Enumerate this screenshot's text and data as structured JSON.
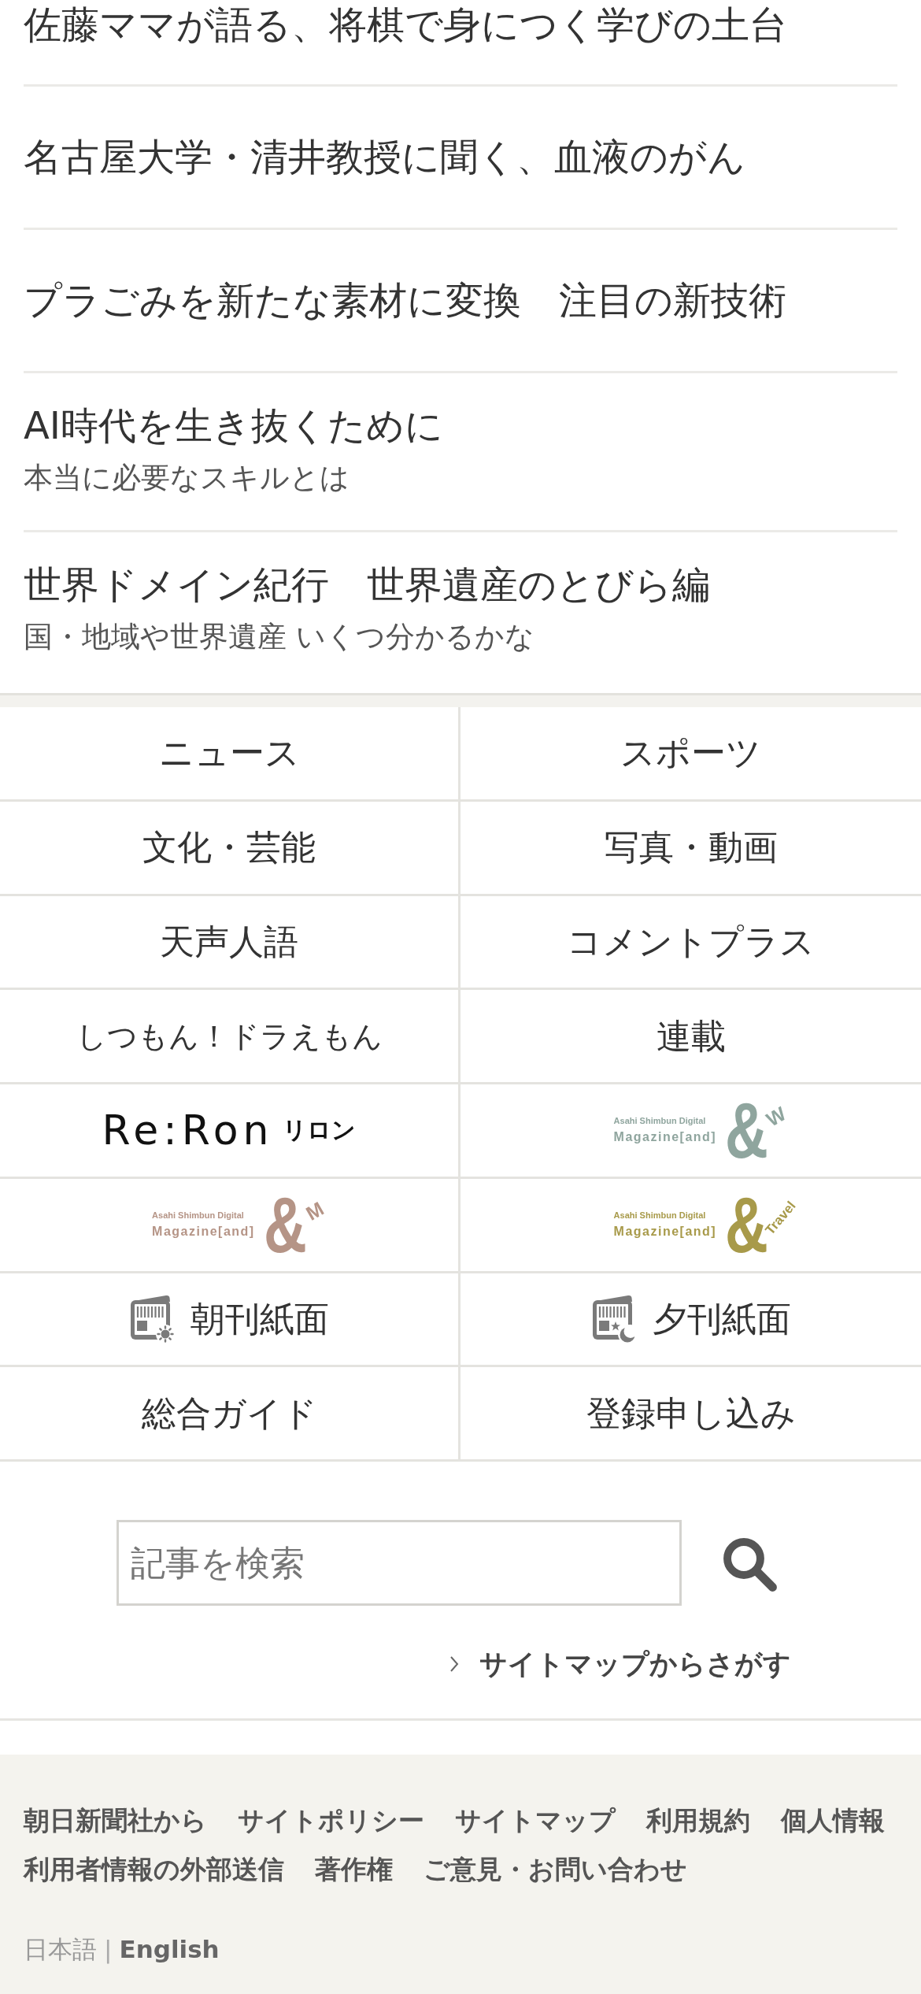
{
  "article_list": [
    {
      "title": "佐藤ママが語る、将棋で身につく学びの土台"
    },
    {
      "title": "名古屋大学・清井教授に聞く、血液のがん"
    },
    {
      "title": "プラごみを新たな素材に変換　注目の新技術"
    },
    {
      "title": "AI時代を生き抜くために",
      "subtitle": "本当に必要なスキルとは"
    },
    {
      "title": "世界ドメイン紀行　世界遺産のとびら編",
      "subtitle": "国・地域や世界遺産 いくつ分かるかな"
    }
  ],
  "nav_grid": [
    {
      "kind": "text",
      "label": "ニュース"
    },
    {
      "kind": "text",
      "label": "スポーツ"
    },
    {
      "kind": "text",
      "label": "文化・芸能"
    },
    {
      "kind": "text",
      "label": "写真・動画"
    },
    {
      "kind": "text",
      "label": "天声人語"
    },
    {
      "kind": "text",
      "label": "コメントプラス"
    },
    {
      "kind": "text",
      "label": "しつもん！ドラえもん"
    },
    {
      "kind": "text",
      "label": "連載"
    },
    {
      "kind": "reron",
      "wordmark": "Re:Ron",
      "kana": "リロン"
    },
    {
      "kind": "magazine",
      "color": "#8fa59e",
      "tagline": "Asahi Shimbun Digital",
      "wordmark": "Magazine[and]",
      "ampersand": "&",
      "suffix": "W"
    },
    {
      "kind": "magazine",
      "color": "#b59486",
      "tagline": "Asahi Shimbun Digital",
      "wordmark": "Magazine[and]",
      "ampersand": "&",
      "suffix": "M"
    },
    {
      "kind": "magazine",
      "color": "#a89a4a",
      "tagline": "Asahi Shimbun Digital",
      "wordmark": "Magazine[and]",
      "ampersand": "&",
      "suffix": "Travel"
    },
    {
      "kind": "morning",
      "label": "朝刊紙面"
    },
    {
      "kind": "evening",
      "label": "夕刊紙面"
    },
    {
      "kind": "text",
      "label": "総合ガイド"
    },
    {
      "kind": "text",
      "label": "登録申し込み"
    }
  ],
  "search": {
    "placeholder": "記事を検索"
  },
  "sitemap_link": {
    "label": "サイトマップからさがす"
  },
  "footer": {
    "links": [
      "朝日新聞社から",
      "サイトポリシー",
      "サイトマップ",
      "利用規約",
      "個人情報",
      "利用者情報の外部送信",
      "著作権",
      "ご意見・お問い合わせ"
    ],
    "languages": [
      {
        "label": "日本語",
        "selected": true
      },
      {
        "label": "English",
        "selected": false
      }
    ],
    "separator": "|"
  }
}
